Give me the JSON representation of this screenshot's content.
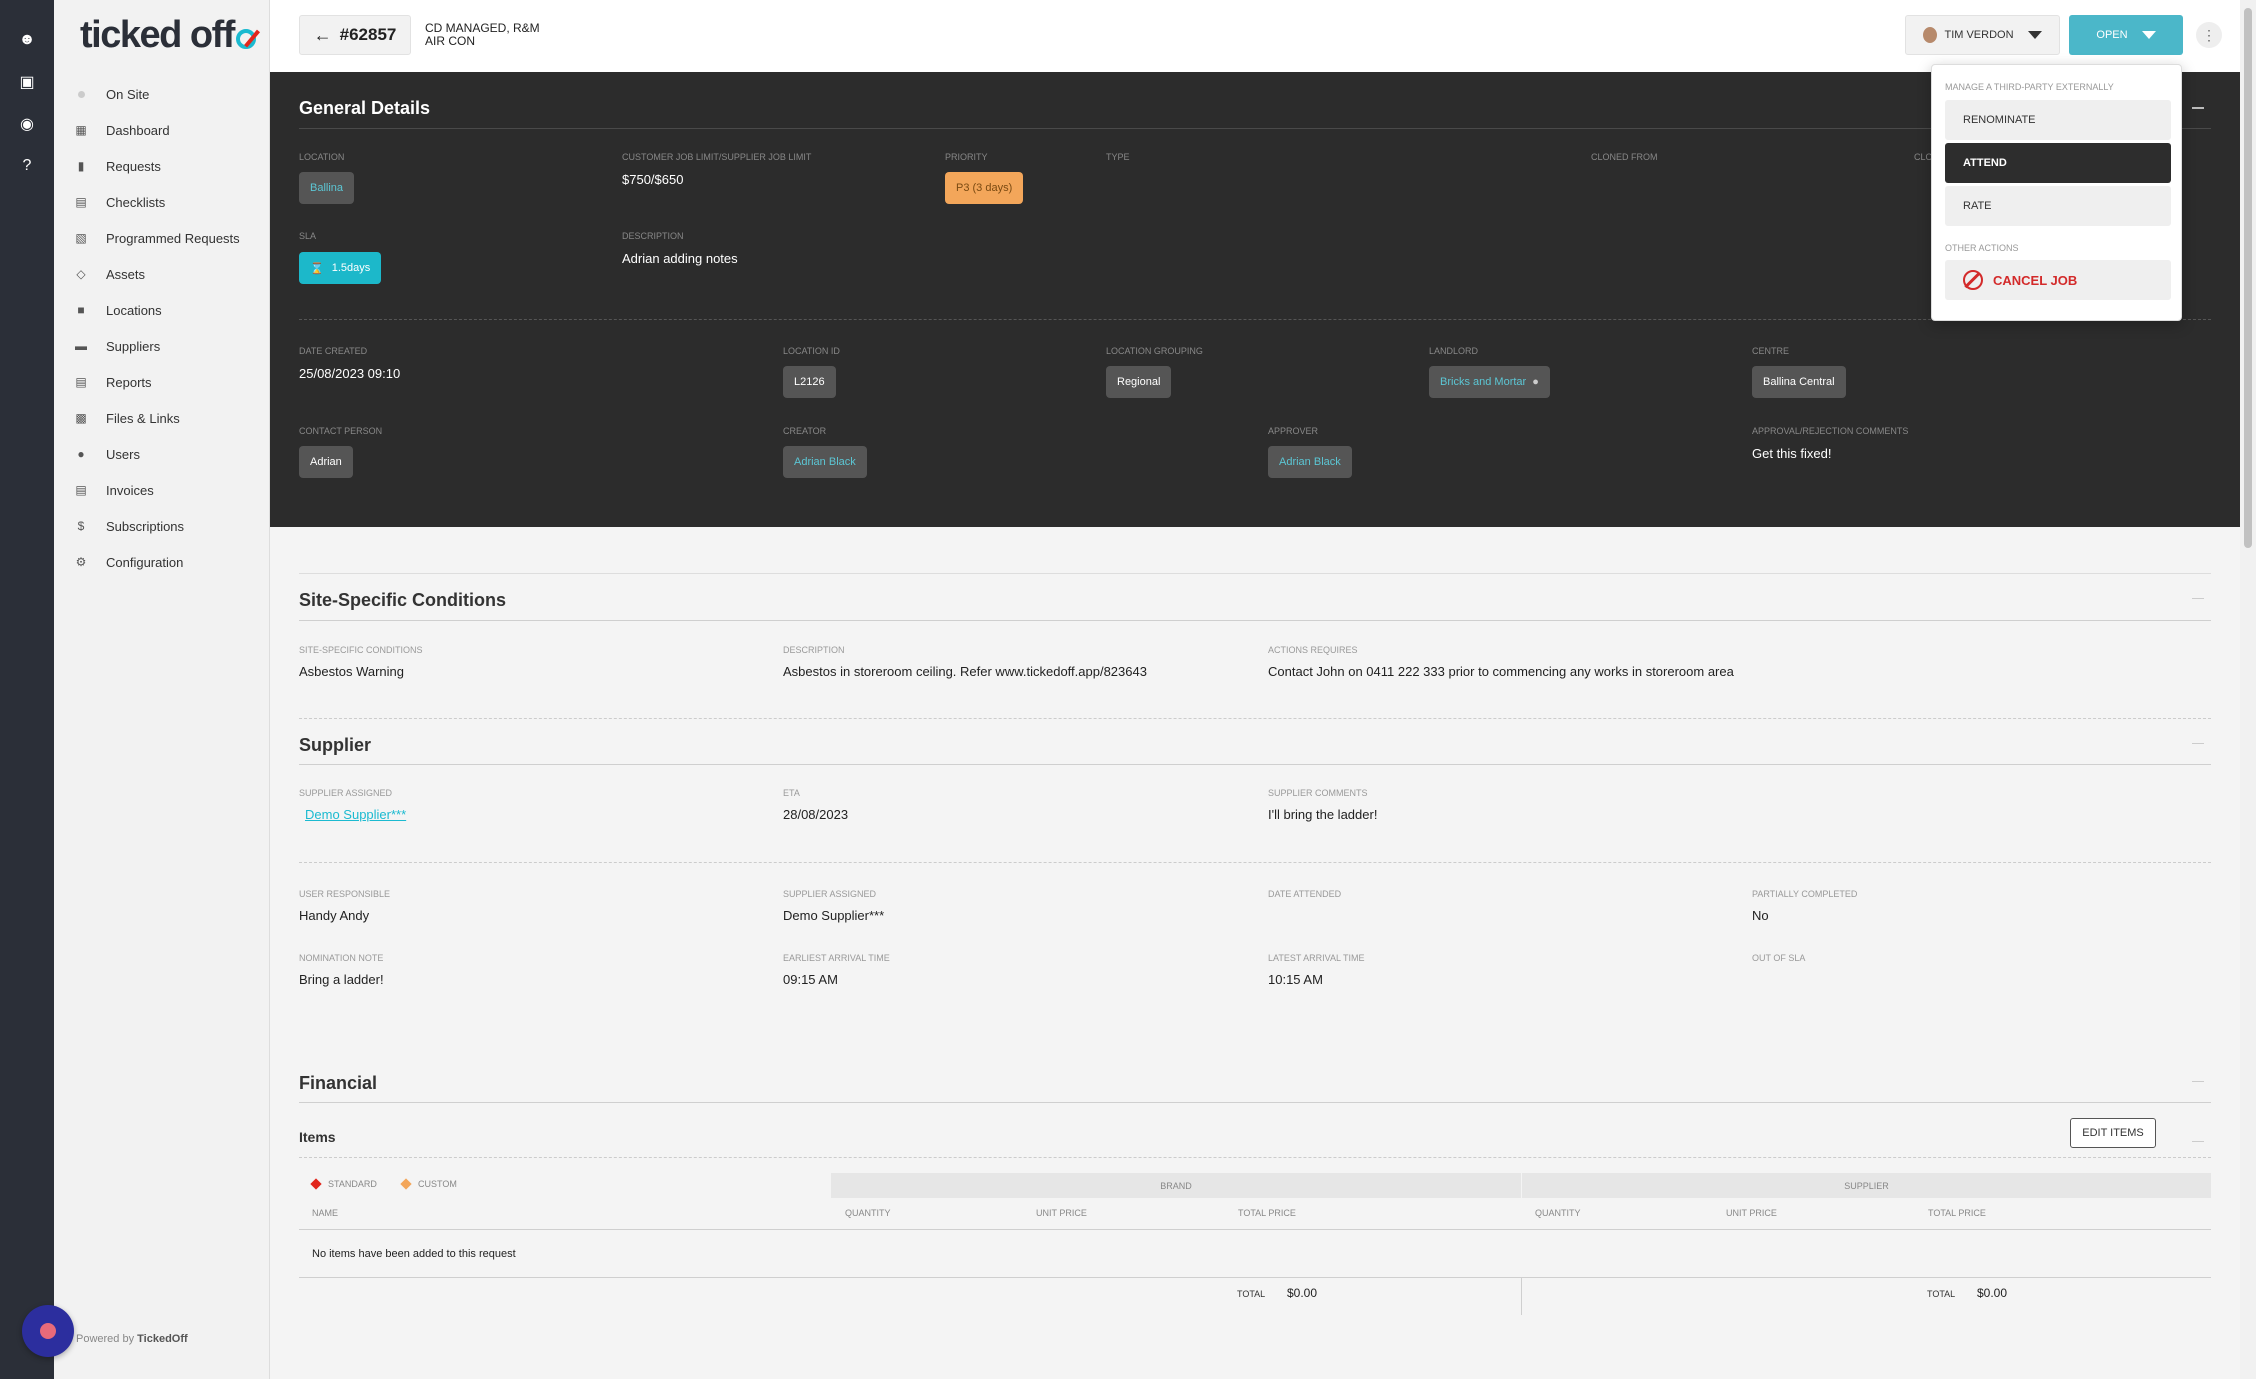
{
  "rail": {
    "icons": [
      "user-circle-icon",
      "calendar-icon",
      "eye-icon",
      "help-icon"
    ]
  },
  "app": {
    "logo_text": "ticked off"
  },
  "sidebar": {
    "items": [
      {
        "label": "On Site",
        "icon": "dot-icon"
      },
      {
        "label": "Dashboard",
        "icon": "dashboard-icon"
      },
      {
        "label": "Requests",
        "icon": "chat-bubble-icon"
      },
      {
        "label": "Checklists",
        "icon": "checklist-icon"
      },
      {
        "label": "Programmed Requests",
        "icon": "calendar-icon"
      },
      {
        "label": "Assets",
        "icon": "assets-icon"
      },
      {
        "label": "Locations",
        "icon": "location-icon"
      },
      {
        "label": "Suppliers",
        "icon": "truck-icon"
      },
      {
        "label": "Reports",
        "icon": "report-icon"
      },
      {
        "label": "Files & Links",
        "icon": "files-icon"
      },
      {
        "label": "Users",
        "icon": "user-icon"
      },
      {
        "label": "Invoices",
        "icon": "invoice-icon"
      },
      {
        "label": "Subscriptions",
        "icon": "dollar-icon"
      },
      {
        "label": "Configuration",
        "icon": "gear-icon"
      }
    ],
    "powered_prefix": "Powered by",
    "powered_brand": "TickedOff"
  },
  "header": {
    "job_number": "#62857",
    "job_subtitle_line1": "CD MANAGED, R&M",
    "job_subtitle_line2": "AIR CON",
    "user_name": "TIM VERDON",
    "status_label": "OPEN"
  },
  "dropdown": {
    "header_third_party": "MANAGE A THIRD-PARTY EXTERNALLY",
    "renominate": "RENOMINATE",
    "attend": "ATTEND",
    "rate": "RATE",
    "header_other": "OTHER ACTIONS",
    "cancel_job": "CANCEL JOB"
  },
  "general": {
    "title": "General Details",
    "location_label": "LOCATION",
    "location_value": "Ballina",
    "limit_label": "CUSTOMER JOB LIMIT/SUPPLIER JOB LIMIT",
    "limit_value": "$750/$650",
    "priority_label": "PRIORITY",
    "priority_value": "P3 (3 days)",
    "type_label": "TYPE",
    "cloned_label": "CLONED FROM",
    "cl_label": "CLO",
    "sla_label": "SLA",
    "sla_value": "1.5days",
    "description_label": "DESCRIPTION",
    "description_value": "Adrian adding notes",
    "date_created_label": "DATE CREATED",
    "date_created_value": "25/08/2023 09:10",
    "location_id_label": "LOCATION ID",
    "location_id_value": "L2126",
    "location_grouping_label": "LOCATION GROUPING",
    "location_grouping_value": "Regional",
    "landlord_label": "LANDLORD",
    "landlord_value": "Bricks and Mortar",
    "centre_label": "CENTRE",
    "centre_value": "Ballina Central",
    "contact_label": "CONTACT PERSON",
    "contact_value": "Adrian",
    "creator_label": "CREATOR",
    "creator_value": "Adrian Black",
    "approver_label": "APPROVER",
    "approver_value": "Adrian Black",
    "approval_label": "APPROVAL/REJECTION COMMENTS",
    "approval_value": "Get this fixed!"
  },
  "site_conditions": {
    "title": "Site-Specific Conditions",
    "cond_label": "SITE-SPECIFIC CONDITIONS",
    "cond_value": "Asbestos Warning",
    "desc_label": "DESCRIPTION",
    "desc_value": "Asbestos in storeroom ceiling. Refer www.tickedoff.app/823643",
    "actions_label": "ACTIONS REQUIRES",
    "actions_value": "Contact John on 0411 222 333 prior to commencing any works in storeroom area"
  },
  "supplier": {
    "title": "Supplier",
    "assigned_label": "SUPPLIER ASSIGNED",
    "assigned_value": "Demo Supplier***",
    "eta_label": "ETA",
    "eta_value": "28/08/2023",
    "comments_label": "SUPPLIER COMMENTS",
    "comments_value": "I'll bring the ladder!",
    "user_resp_label": "USER RESPONSIBLE",
    "user_resp_value": "Handy Andy",
    "assigned2_label": "SUPPLIER ASSIGNED",
    "assigned2_value": "Demo Supplier***",
    "date_attended_label": "DATE ATTENDED",
    "partial_label": "PARTIALLY COMPLETED",
    "partial_value": "No",
    "nomination_label": "NOMINATION NOTE",
    "nomination_value": "Bring a ladder!",
    "earliest_label": "EARLIEST ARRIVAL TIME",
    "earliest_value": "09:15 AM",
    "latest_label": "LATEST ARRIVAL TIME",
    "latest_value": "10:15 AM",
    "out_sla_label": "OUT OF SLA"
  },
  "financial": {
    "title": "Financial",
    "items_title": "Items",
    "edit_items": "EDIT ITEMS",
    "legend_standard": "STANDARD",
    "legend_custom": "CUSTOM",
    "group_brand": "BRAND",
    "group_supplier": "SUPPLIER",
    "col_name": "NAME",
    "col_quantity": "QUANTITY",
    "col_unit_price": "UNIT PRICE",
    "col_total_price": "TOTAL PRICE",
    "empty_message": "No items have been added to this request",
    "total_label": "TOTAL",
    "brand_total": "$0.00",
    "supplier_total": "$0.00"
  }
}
